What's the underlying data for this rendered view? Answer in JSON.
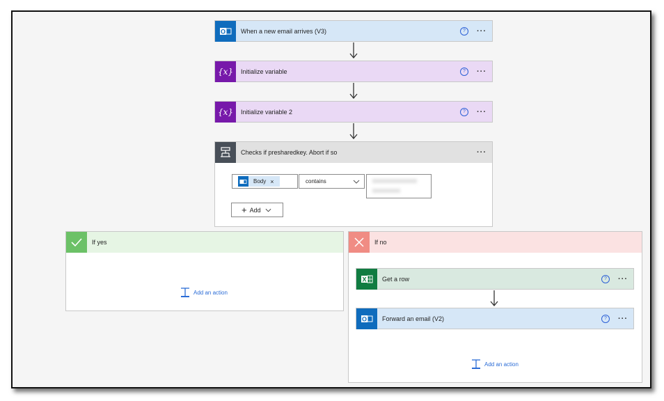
{
  "flow": {
    "trigger": {
      "title": "When a new email arrives (V3)",
      "help": "?",
      "more": "···",
      "icon": "outlook-icon"
    },
    "init_var_1": {
      "title": "Initialize variable",
      "help": "?",
      "more": "···",
      "icon": "variable-icon"
    },
    "init_var_2": {
      "title": "Initialize variable 2",
      "help": "?",
      "more": "···",
      "icon": "variable-icon"
    },
    "condition": {
      "title": "Checks if presharedkey. Abort if so",
      "more": "···",
      "icon": "condition-icon",
      "token_label": "Body",
      "token_remove": "×",
      "operator": "contains",
      "add_label": "Add"
    },
    "if_yes": {
      "title": "If yes",
      "add_action": "Add an action"
    },
    "if_no": {
      "title": "If no",
      "get_row": {
        "title": "Get a row",
        "help": "?",
        "more": "···",
        "icon": "excel-icon"
      },
      "forward": {
        "title": "Forward an email (V2)",
        "help": "?",
        "more": "···",
        "icon": "outlook-icon"
      },
      "add_action": "Add an action"
    }
  },
  "colors": {
    "outlook": "#0f6cbd",
    "variable": "#7719aa",
    "condition": "#484f58",
    "excel": "#107c41",
    "yes": "#6cc167",
    "no": "#f08c84",
    "link": "#2b6cd6"
  }
}
